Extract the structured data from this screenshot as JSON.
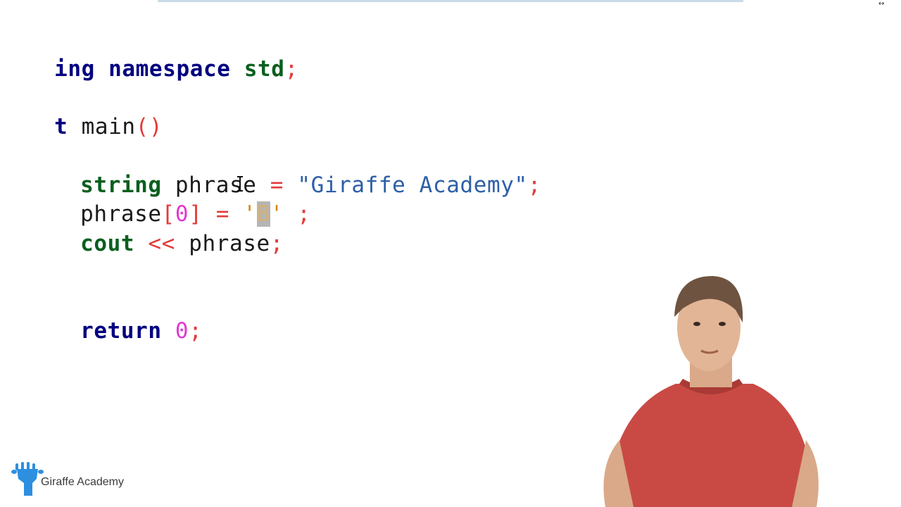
{
  "code": {
    "line1": [
      "ing",
      " namespace",
      " std",
      ";"
    ],
    "line2": [
      "t",
      " main",
      "()"
    ],
    "line3": [
      "string",
      " phrase",
      " = ",
      "\"Giraffe Academy\"",
      ";"
    ],
    "line4": [
      "phrase",
      "[",
      "0",
      "]",
      " = ",
      "'",
      "B",
      "'",
      " ;"
    ],
    "line5": [
      "cout",
      " << ",
      "phrase",
      ";"
    ],
    "line6": [
      "return",
      " ",
      "0",
      ";"
    ]
  },
  "branding": {
    "logo_text": "Giraffe Academy",
    "logo_icon": "giraffe-icon",
    "brand_color": "#2d8fe0"
  },
  "colors": {
    "keyword": "#0a5f1f",
    "string": "#2d5fa8",
    "operator": "#e23b3b",
    "number": "#e03ad2"
  }
}
